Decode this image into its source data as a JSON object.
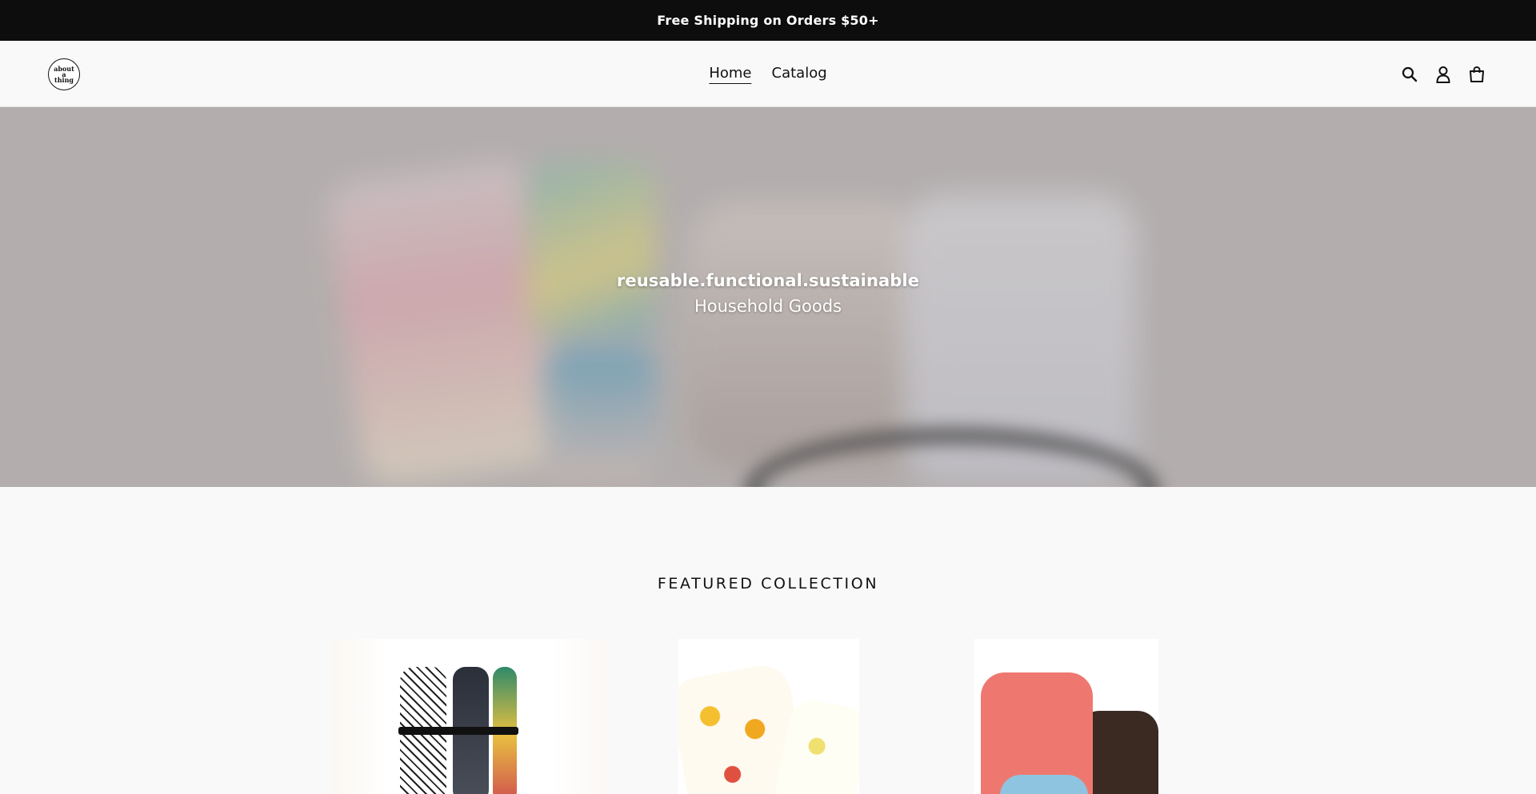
{
  "announcement": {
    "text": "Free Shipping on Orders $50+"
  },
  "header": {
    "logo_text": "about a thing",
    "nav": [
      {
        "label": "Home",
        "active": true
      },
      {
        "label": "Catalog",
        "active": false
      }
    ],
    "icons": [
      "search-icon",
      "account-icon",
      "cart-icon"
    ]
  },
  "hero": {
    "title": "reusable.functional.sustainable",
    "subtitle": "Household Goods"
  },
  "featured": {
    "title": "FEATURED COLLECTION"
  },
  "colors": {
    "announcement_bg": "#0d0d0d",
    "page_bg": "#f9f9f9",
    "text": "#111111"
  }
}
